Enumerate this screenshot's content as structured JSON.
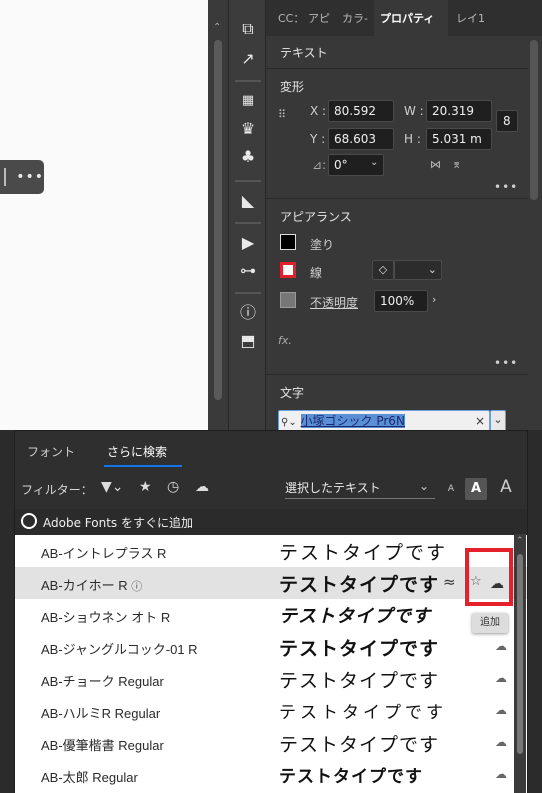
{
  "panel": {
    "tabs": [
      "CC：",
      "アピ",
      "カラ-",
      "プロパティ",
      "レイ1"
    ],
    "active_tab": "プロパティ",
    "text_section": "テキスト",
    "transform": {
      "title": "変形",
      "x_label": "X :",
      "x_value": "80.592",
      "w_label": "W :",
      "w_value": "20.319",
      "y_label": "Y :",
      "y_value": "68.603",
      "h_label": "H :",
      "h_value": "5.031 m",
      "angle_label": "⊿:",
      "angle_value": "0°"
    },
    "appearance": {
      "title": "アピアランス",
      "fill_label": "塗り",
      "stroke_label": "線",
      "opacity_label": "不透明度",
      "opacity_value": "100%"
    },
    "fx_label": "fx.",
    "character": {
      "title": "文字",
      "font_search_value": "小塚ゴシック Pr6N"
    }
  },
  "font_panel": {
    "tabs": [
      "フォント",
      "さらに検索"
    ],
    "active_tab": "さらに検索",
    "filter_label": "フィルター：",
    "sample_select": "選択したテキスト",
    "size_options": [
      "A",
      "A",
      "A"
    ],
    "adobe_fonts_label": "Adobe Fonts をすぐに追加",
    "sample_text": "テストタイプです",
    "fonts": [
      {
        "name": "AB-イントレプラス R"
      },
      {
        "name": "AB-カイホー R"
      },
      {
        "name": "AB-ショウネン オト R"
      },
      {
        "name": "AB-ジャングルコック-01 R"
      },
      {
        "name": "AB-チョーク Regular"
      },
      {
        "name": "AB-ハルミR Regular"
      },
      {
        "name": "AB-優筆楷書 Regular"
      },
      {
        "name": "AB-太郎 Regular"
      }
    ],
    "highlighted_index": 1,
    "tooltip": "追加",
    "similar_icon": "≈"
  },
  "colors": {
    "accent": "#1473e6",
    "highlight_box": "#e5202a"
  }
}
